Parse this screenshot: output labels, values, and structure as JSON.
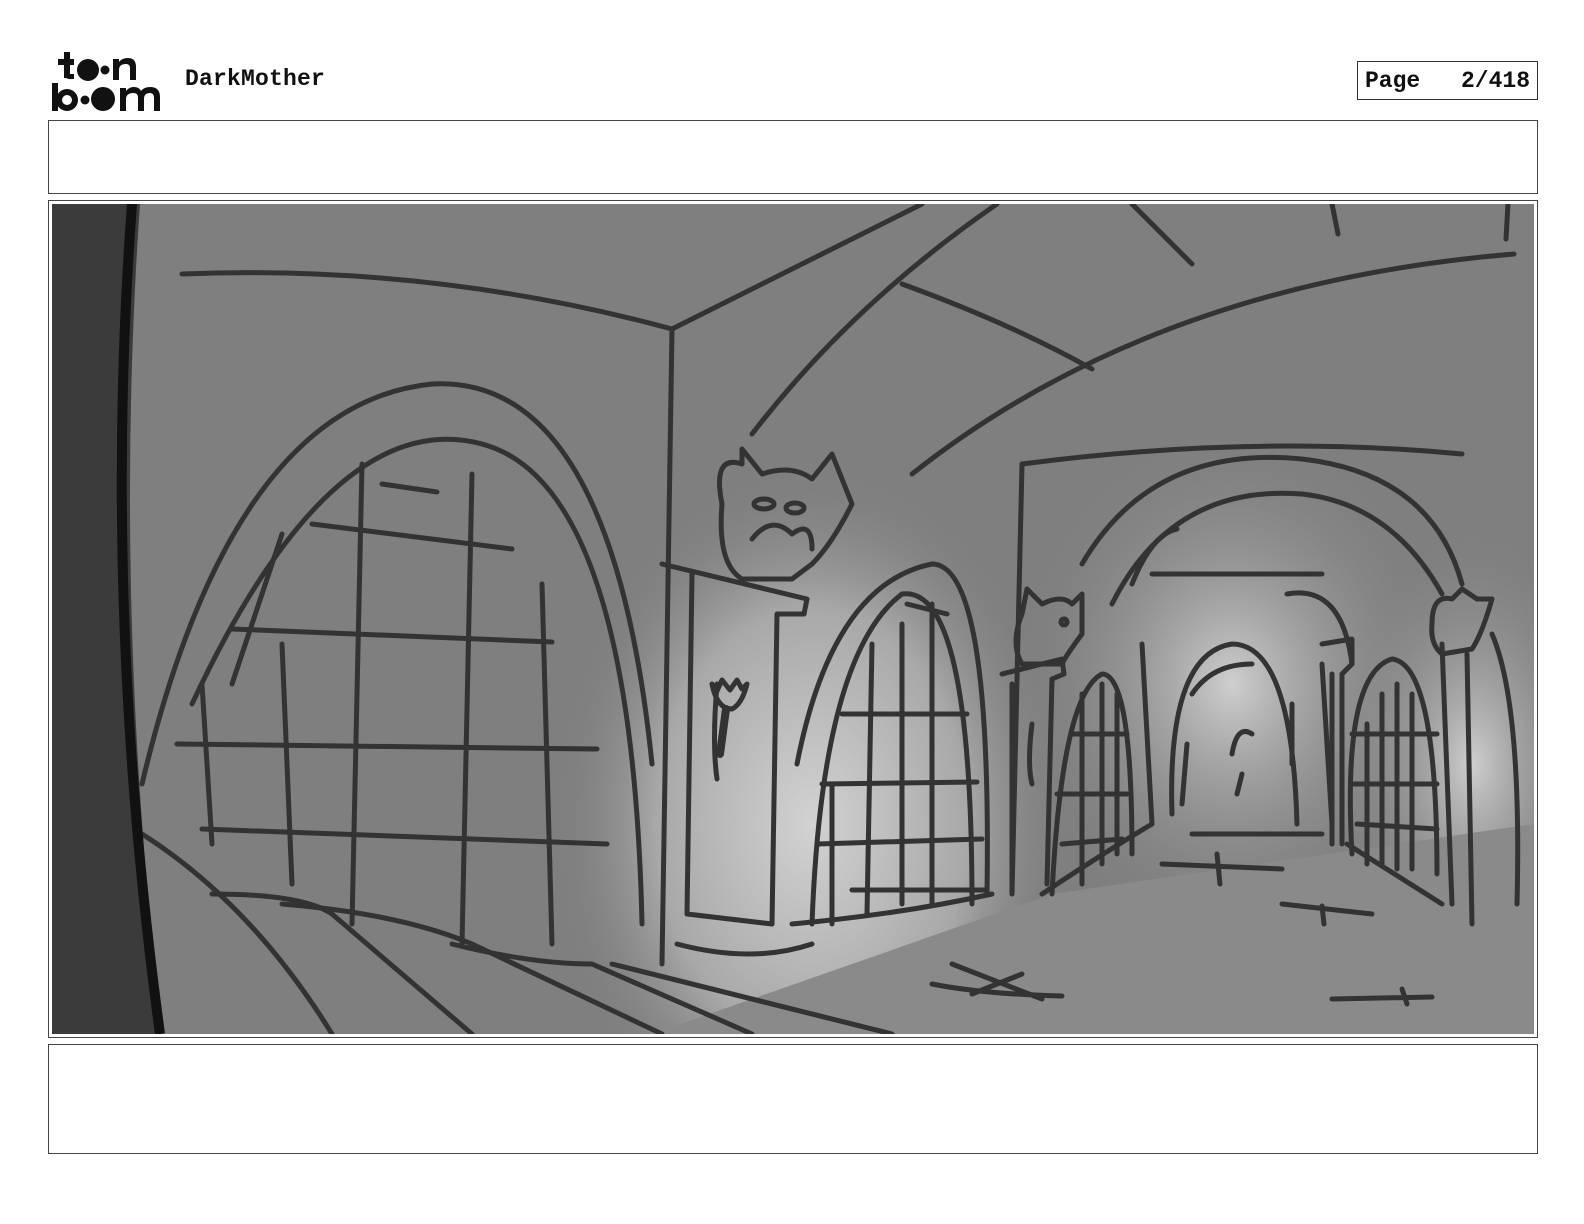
{
  "header": {
    "logo_text": "toon boom",
    "project_title": "DarkMother",
    "page_label": "Page",
    "page_number": "2/418"
  },
  "panel": {
    "top_caption": "",
    "bottom_caption": "",
    "image_description_icon": "storyboard-sketch"
  },
  "colors": {
    "sketch_background": "#7f7f7f",
    "line_color": "#3a3a3a",
    "glow": "#cfcfcf"
  }
}
